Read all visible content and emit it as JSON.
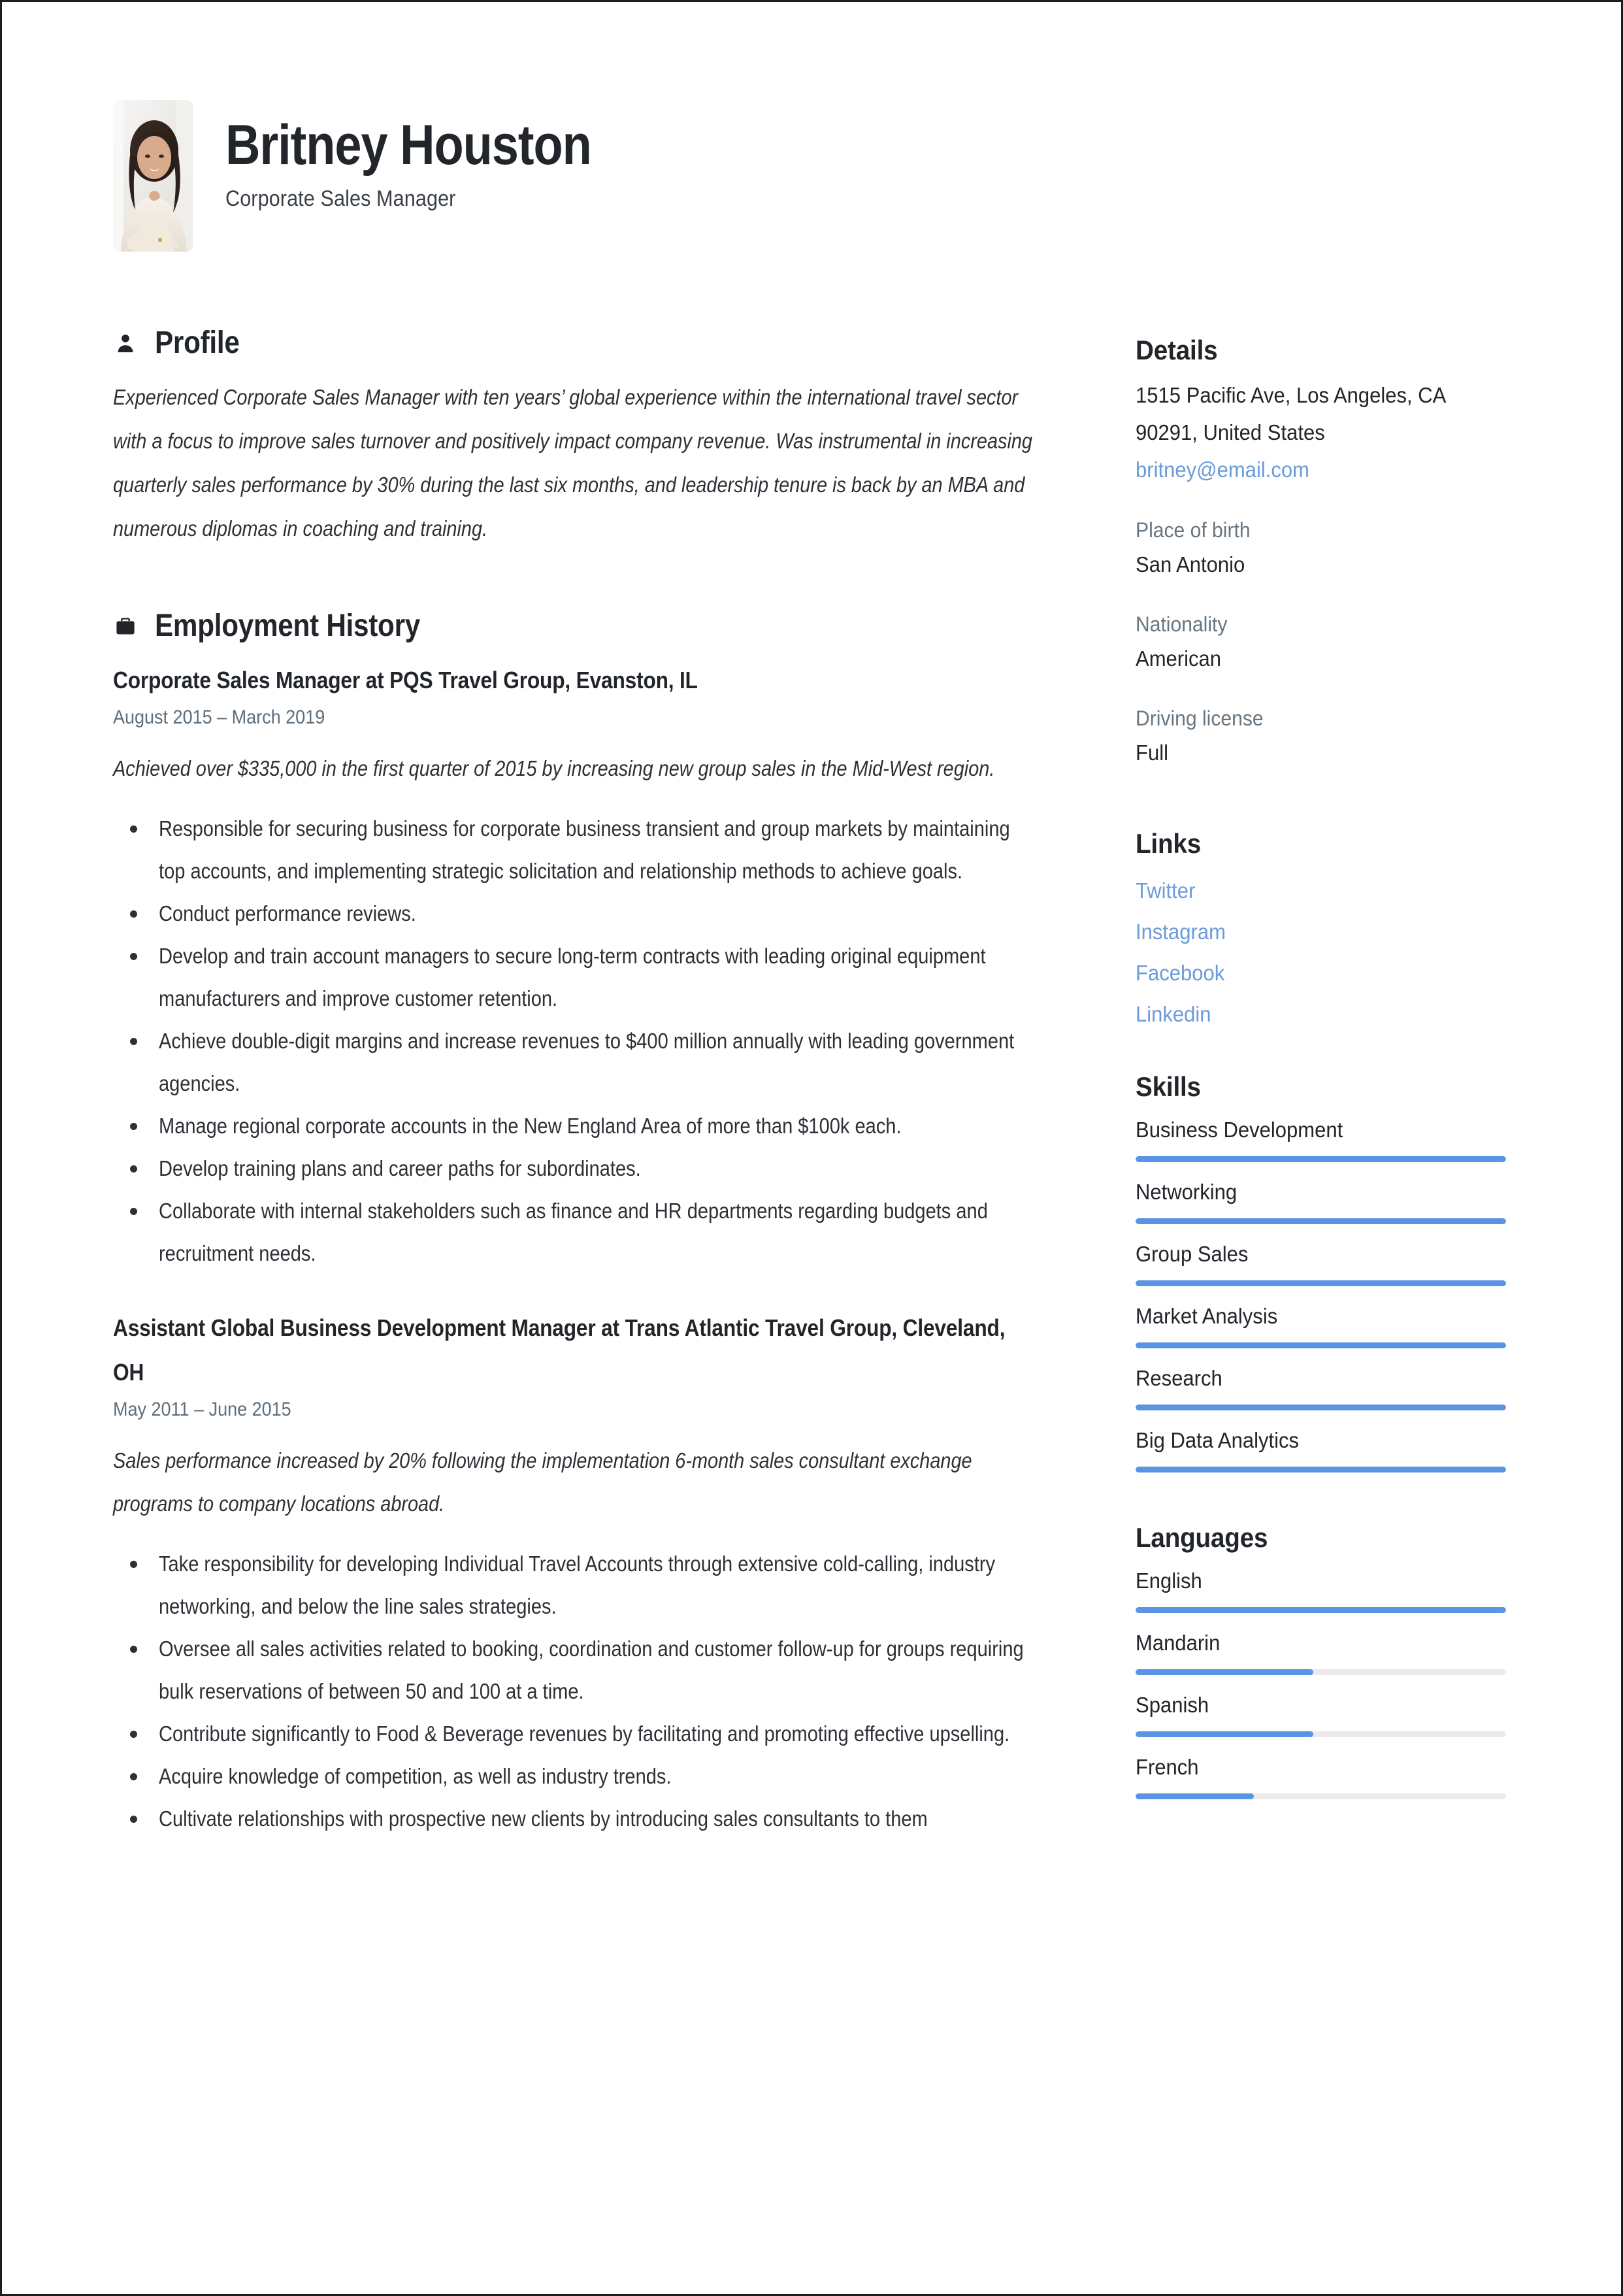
{
  "header": {
    "name": "Britney Houston",
    "job_title": "Corporate Sales Manager",
    "photo_alt": "profile-photo"
  },
  "profile": {
    "section_title": "Profile",
    "icon": "person-icon",
    "text": "Experienced Corporate Sales Manager with ten years’ global experience within the international travel sector with a focus to improve sales turnover and positively impact company revenue. Was instrumental in increasing quarterly sales performance by 30% during the last six months, and leadership tenure is back by an MBA and numerous diplomas in coaching and training."
  },
  "employment": {
    "section_title": "Employment History",
    "icon": "briefcase-icon",
    "jobs": [
      {
        "heading": "Corporate Sales Manager at PQS Travel Group, Evanston, IL",
        "dates": "August 2015  –  March 2019",
        "summary": "Achieved over $335,000 in the first quarter of 2015 by increasing new group sales in the Mid-West region.",
        "bullets": [
          "Responsible for securing business for corporate business transient and group markets by maintaining top accounts, and implementing strategic solicitation and relationship methods to achieve goals.",
          "Conduct performance reviews.",
          "Develop and train account managers to secure long-term contracts with leading original equipment manufacturers and improve customer retention.",
          "Achieve double-digit margins and increase revenues to $400 million annually with leading government agencies.",
          "Manage regional corporate accounts in the New England Area of more than $100k each.",
          "Develop training plans and career paths for subordinates.",
          "Collaborate with internal stakeholders such as finance and HR departments regarding budgets and recruitment needs."
        ]
      },
      {
        "heading": "Assistant Global Business Development Manager at Trans Atlantic Travel Group, Cleveland, OH",
        "dates": "May 2011  –  June 2015",
        "summary": "Sales performance increased by 20% following the implementation 6-month sales consultant exchange programs to company locations abroad.",
        "bullets": [
          "Take responsibility for developing Individual Travel Accounts through extensive cold-calling, industry networking, and below the line sales strategies.",
          "Oversee all sales activities related to booking, coordination and customer follow-up for groups requiring bulk reservations of between 50 and 100 at a time.",
          "Contribute significantly to Food & Beverage revenues by facilitating and promoting effective upselling.",
          "Acquire knowledge of competition, as well as industry trends.",
          "Cultivate relationships with prospective new clients by introducing sales consultants to them"
        ]
      }
    ]
  },
  "details": {
    "section_title": "Details",
    "address_line1": "1515 Pacific Ave, Los Angeles, CA",
    "address_line2": "90291, United States",
    "email": "britney@email.com",
    "fields": [
      {
        "label": "Place of birth",
        "value": "San Antonio"
      },
      {
        "label": "Nationality",
        "value": "American"
      },
      {
        "label": "Driving license",
        "value": "Full"
      }
    ]
  },
  "links": {
    "section_title": "Links",
    "items": [
      "Twitter",
      "Instagram",
      "Facebook",
      "Linkedin"
    ]
  },
  "skills": {
    "section_title": "Skills",
    "items": [
      {
        "name": "Business Development",
        "level": 100
      },
      {
        "name": "Networking",
        "level": 100
      },
      {
        "name": "Group Sales",
        "level": 100
      },
      {
        "name": "Market Analysis",
        "level": 100
      },
      {
        "name": "Research",
        "level": 100
      },
      {
        "name": "Big Data Analytics",
        "level": 100
      }
    ]
  },
  "languages": {
    "section_title": "Languages",
    "items": [
      {
        "name": "English",
        "level": 100
      },
      {
        "name": "Mandarin",
        "level": 48
      },
      {
        "name": "Spanish",
        "level": 48
      },
      {
        "name": "French",
        "level": 32
      }
    ]
  },
  "colors": {
    "accent": "#5b94e3",
    "link": "#6b9bd9",
    "text": "#22262b",
    "muted": "#69767f",
    "date": "#5e6e7b",
    "track": "#eceaea"
  }
}
